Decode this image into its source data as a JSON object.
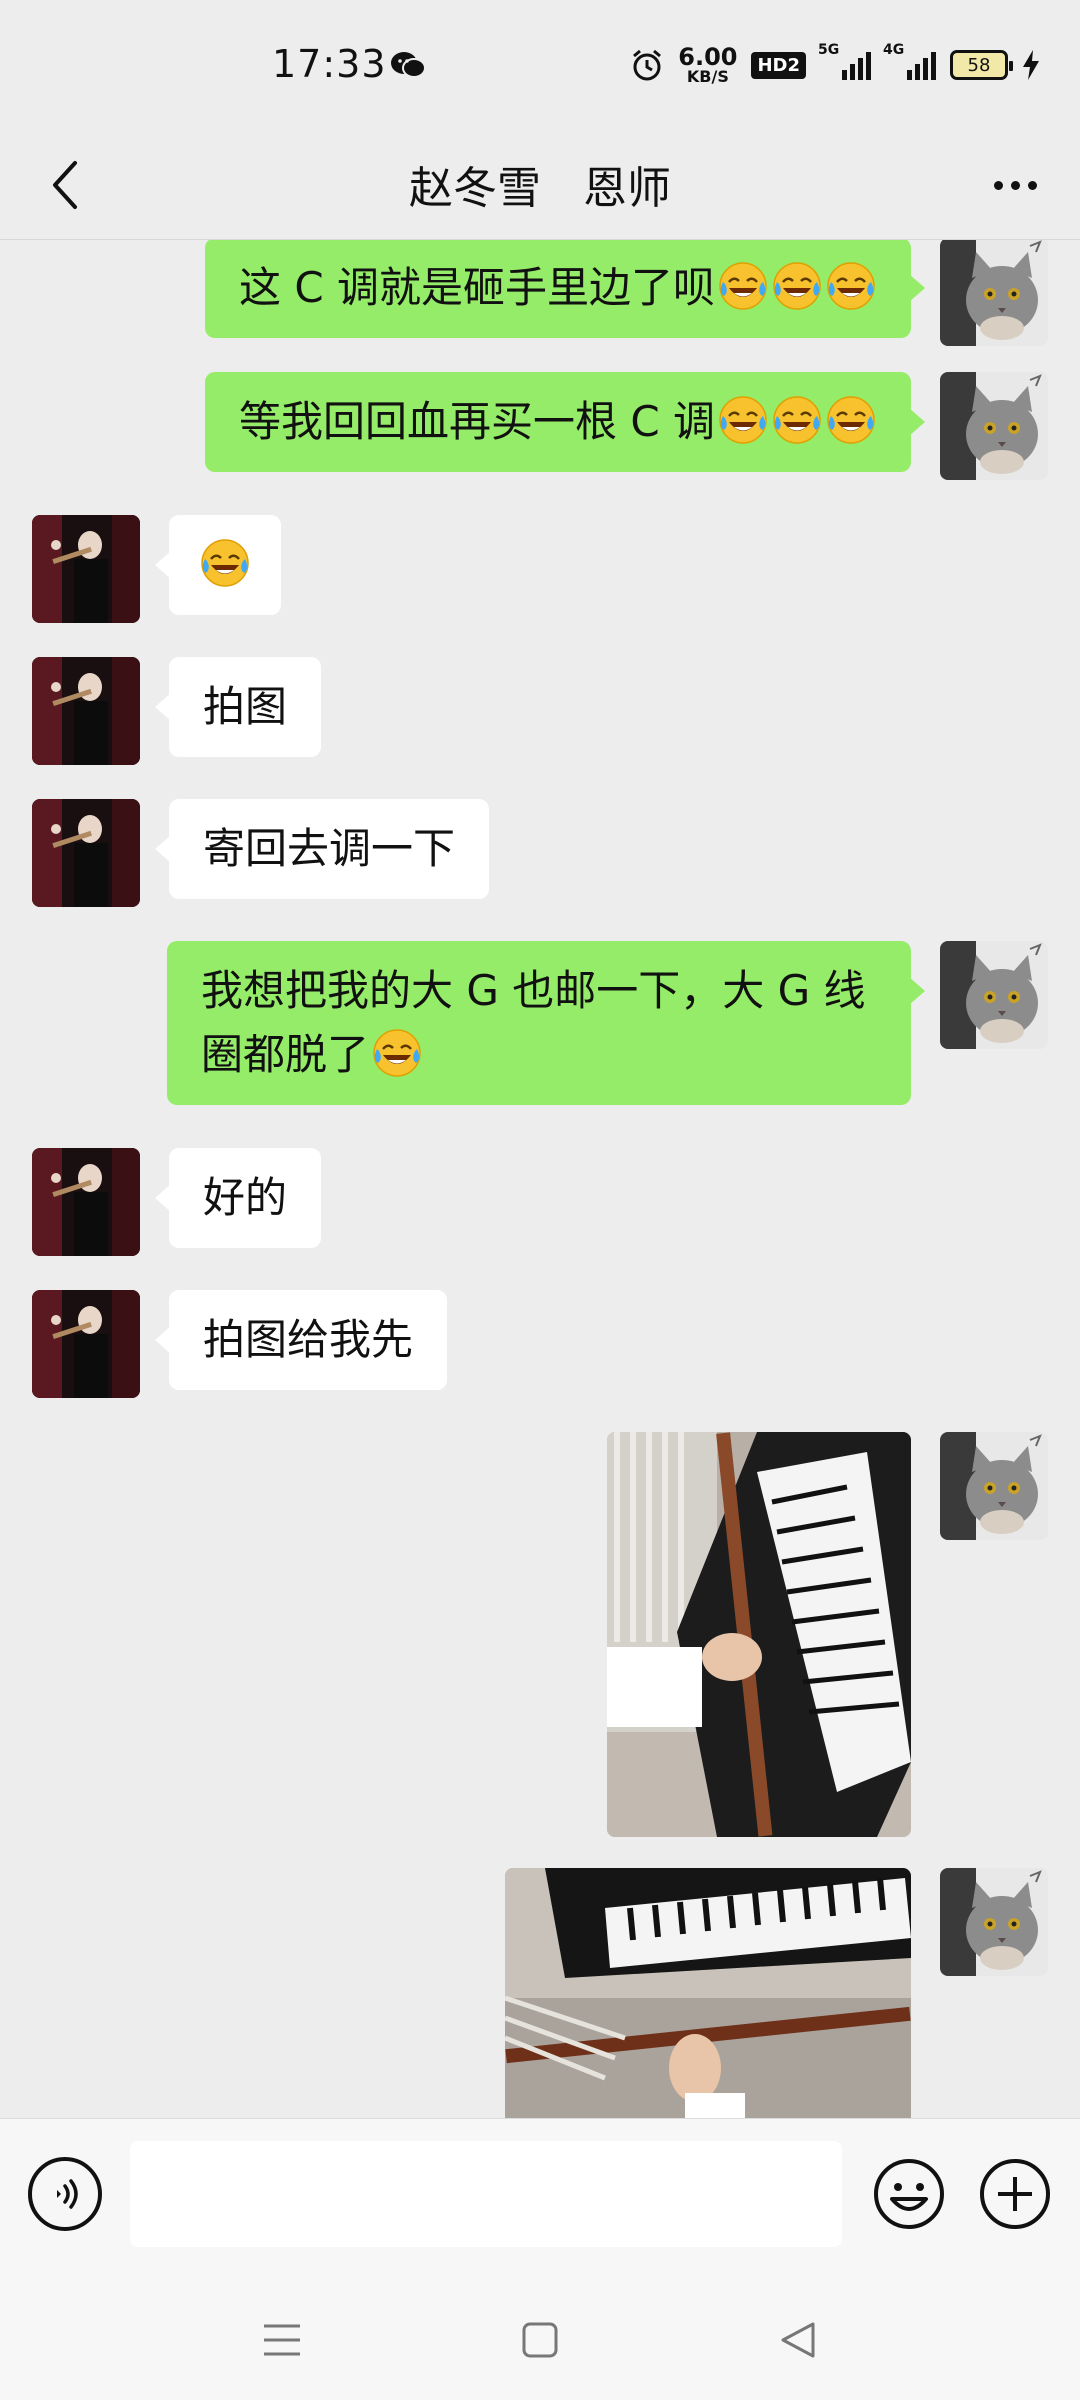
{
  "status_bar": {
    "time": "17:33",
    "net_speed_value": "6.00",
    "net_speed_unit": "KB/S",
    "hd_badge": "HD2",
    "sim1_tag": "5G",
    "sim2_tag": "4G",
    "battery_level": "58"
  },
  "nav": {
    "title": "赵冬雪   恩师"
  },
  "messages": [
    {
      "from": "me",
      "text": "这 C 调就是砸手里边了呗",
      "emoji_count": 3
    },
    {
      "from": "me",
      "text": "等我回回血再买一根 C 调",
      "emoji_count": 3
    },
    {
      "from": "them",
      "text": "",
      "emoji_count": 1
    },
    {
      "from": "them",
      "text": "拍图",
      "emoji_count": 0
    },
    {
      "from": "them",
      "text": "寄回去调一下",
      "emoji_count": 0
    },
    {
      "from": "me",
      "text_line1": "我想把我的大 G 也邮一下，大 G 线",
      "text_line2": "圈都脱了",
      "emoji_count": 1
    },
    {
      "from": "them",
      "text": "好的",
      "emoji_count": 0
    },
    {
      "from": "them",
      "text": "拍图给我先",
      "emoji_count": 0
    },
    {
      "from": "me",
      "type": "image",
      "content": "photo-flute-piano-1"
    },
    {
      "from": "me",
      "type": "image",
      "content": "photo-flute-piano-2"
    }
  ],
  "input": {
    "placeholder": ""
  },
  "colors": {
    "my_bubble": "#95ec69",
    "their_bubble": "#ffffff",
    "background": "#ededed"
  }
}
